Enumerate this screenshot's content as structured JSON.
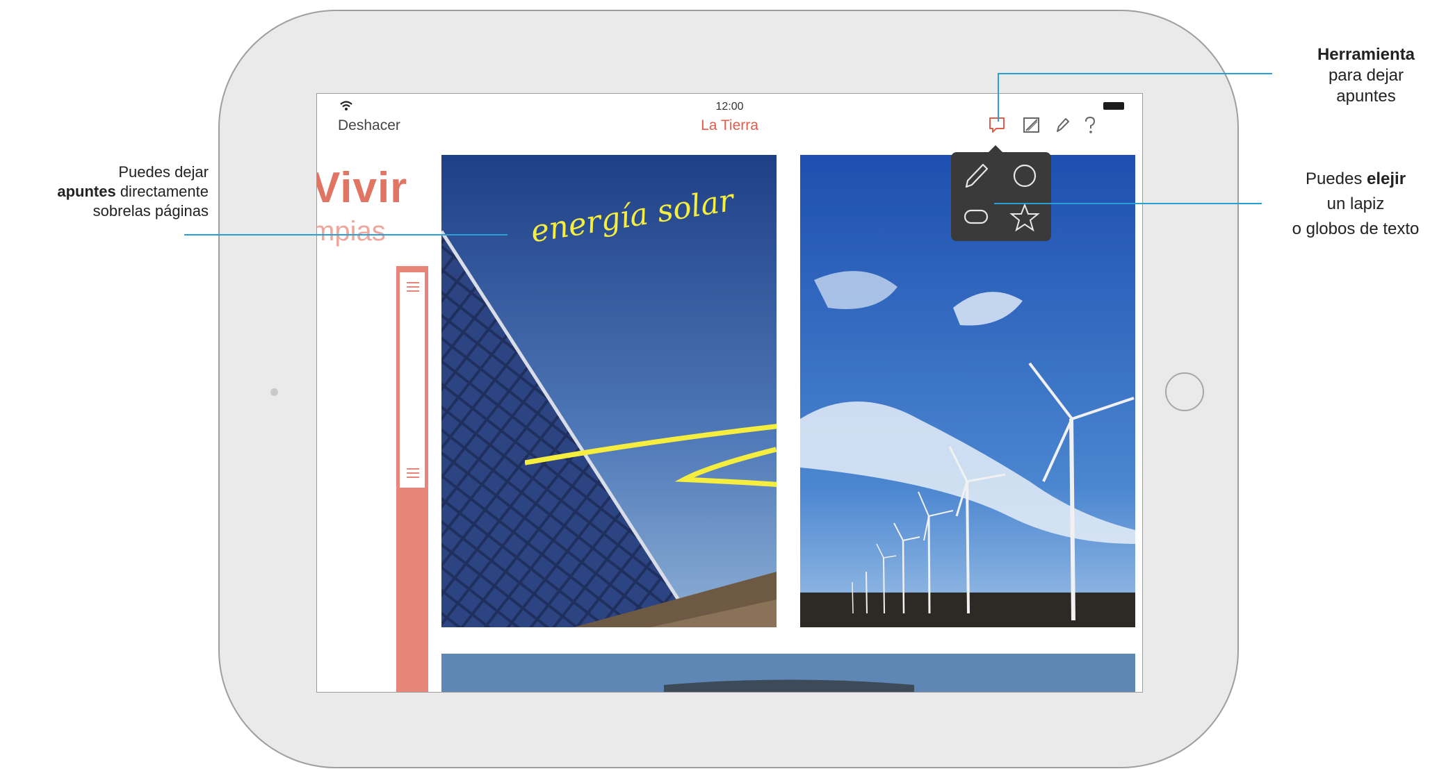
{
  "status_bar": {
    "time": "12:00"
  },
  "nav": {
    "undo_label": "Deshacer",
    "title": "La Tierra"
  },
  "toolbar": {
    "icons": [
      "note-bubble-icon",
      "image-edit-icon",
      "pencil-icon",
      "help-icon"
    ],
    "active_color": "#e05d4c"
  },
  "page": {
    "heading": "Vivir",
    "subheading": "mpias",
    "handwritten_note": "energía solar"
  },
  "popover": {
    "options": [
      "pencil-icon",
      "circle-shape-icon",
      "rounded-rect-shape-icon",
      "star-shape-icon"
    ]
  },
  "callouts": {
    "left": {
      "line1": "Puedes dejar",
      "line2_bold": "apuntes",
      "line2_rest": " directamente",
      "line3": "sobrelas páginas"
    },
    "top_right": {
      "line1_bold": "Herramienta",
      "line2": "para dejar",
      "line3": "apuntes"
    },
    "mid_right": {
      "line1_pre": "Puedes ",
      "line1_bold": "elejir",
      "line2": "un lapiz",
      "line3": "o globos de texto"
    }
  },
  "colors": {
    "accent": "#e05d4c",
    "callout_line": "#2a9fd6",
    "note_ink": "#f5ee3f"
  }
}
